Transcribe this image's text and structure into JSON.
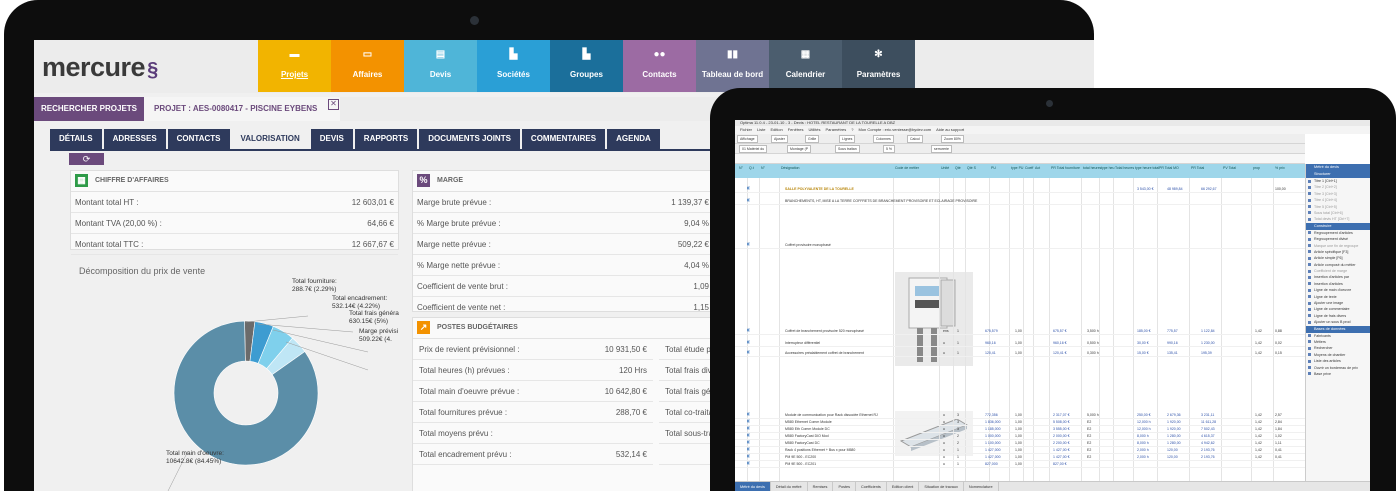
{
  "crm": {
    "logo": "mercure",
    "nav": [
      {
        "label": "Projets",
        "color": "#f2b400",
        "icon": "folder-icon"
      },
      {
        "label": "Affaires",
        "color": "#f39200",
        "icon": "folder-open-icon"
      },
      {
        "label": "Devis",
        "color": "#4fb5d8",
        "icon": "document-icon"
      },
      {
        "label": "Sociétés",
        "color": "#2a9fd6",
        "icon": "factory-icon"
      },
      {
        "label": "Groupes",
        "color": "#1b6f9b",
        "icon": "factory-group-icon"
      },
      {
        "label": "Contacts",
        "color": "#9c6ba3",
        "icon": "people-icon"
      },
      {
        "label": "Tableau de bord",
        "color": "#6f7392",
        "icon": "bar-chart-icon"
      },
      {
        "label": "Calendrier",
        "color": "#4b5d6e",
        "icon": "calendar-icon"
      },
      {
        "label": "Paramètres",
        "color": "#3d4e5e",
        "icon": "gears-icon"
      }
    ],
    "search_tab": "RECHERCHER PROJETS",
    "project_tab": "PROJET : AES-0080417 - PISCINE EYBENS",
    "close_symbol": "✕",
    "subtabs": [
      "DÉTAILS",
      "ADRESSES",
      "CONTACTS",
      "VALORISATION",
      "DEVIS",
      "RAPPORTS",
      "DOCUMENTS JOINTS",
      "COMMENTAIRES",
      "AGENDA"
    ],
    "chiffre": {
      "title": "CHIFFRE D'AFFAIRES",
      "rows": [
        {
          "label": "Montant total HT :",
          "value": "12 603,01 €"
        },
        {
          "label": "Montant TVA (20,00 %) :",
          "value": "64,66 €"
        },
        {
          "label": "Montant total TTC :",
          "value": "12 667,67 €"
        }
      ]
    },
    "marge": {
      "title": "MARGE",
      "rows": [
        {
          "label": "Marge brute prévue :",
          "value": "1 139,37 €"
        },
        {
          "label": "% Marge brute prévue :",
          "value": "9,04 %"
        },
        {
          "label": "Marge nette prévue :",
          "value": "509,22 €"
        },
        {
          "label": "% Marge nette prévue :",
          "value": "4,04 %"
        },
        {
          "label": "Coefficient de vente brut :",
          "value": "1,09"
        },
        {
          "label": "Coefficient de vente net :",
          "value": "1,15"
        }
      ]
    },
    "postes": {
      "title": "POSTES BUDGÉTAIRES",
      "rows": [
        {
          "label": "Prix de revient prévisionnel :",
          "value": "10 931,50 €",
          "right": "Total étude prév"
        },
        {
          "label": "Total heures (h) prévues :",
          "value": "120 Hrs",
          "right": "Total frais divers p"
        },
        {
          "label": "Total main d'oeuvre prévue :",
          "value": "10 642,80 €",
          "right": "Total frais généra"
        },
        {
          "label": "Total fournitures prévue :",
          "value": "288,70 €",
          "right": "Total co-traitance"
        },
        {
          "label": "Total moyens prévu :",
          "value": "",
          "right": "Total sous-traitan"
        },
        {
          "label": "Total encadrement prévu :",
          "value": "532,14 €",
          "right": ""
        }
      ]
    },
    "pie_title": "Décomposition du prix de vente",
    "pie_labels": [
      {
        "name": "Total fourniture:",
        "value": "288.7€ (2.29%)"
      },
      {
        "name": "Total encadrement:",
        "value": "532.14€ (4.22%)"
      },
      {
        "name": "Total frais généra",
        "value": "630.15€ (5%)"
      },
      {
        "name": "Marge prévisi",
        "value": "509.22€ (4."
      },
      {
        "name": "Total main d'oeuvre:",
        "value": "10642.8€ (84.45%)"
      }
    ]
  },
  "chart_data": {
    "type": "pie",
    "title": "Décomposition du prix de vente",
    "categories": [
      "Total main d'oeuvre",
      "Total fourniture",
      "Total encadrement",
      "Total frais généraux",
      "Marge prévisionnelle"
    ],
    "values": [
      10642.8,
      288.7,
      532.14,
      630.15,
      509.22
    ],
    "percent": [
      84.45,
      2.29,
      4.22,
      5.0,
      4.04
    ],
    "colors": [
      "#5b8ea8",
      "#6b6b6b",
      "#3d9cd1",
      "#7fd0ec",
      "#bfe6f5"
    ],
    "donut": true
  },
  "optima": {
    "window_title": "Optima 11.0.4 - 23-01-10 - 3 - Devis : HOTEL RESTAURANT DE LA TOURELLE A DBZ",
    "menu": [
      "Fichier",
      "Liste",
      "Edition",
      "Fenêtres",
      "Utilités",
      "Paramètres",
      "?",
      "Mon Compte : eric.veniesse@bydev.com",
      "Aide au support"
    ],
    "toolbar1": [
      "Affichage",
      "Ajuster",
      "Grille",
      "Lignes",
      "Colonnes",
      "Calcul",
      "Zoom 80%"
    ],
    "toolbar2": [
      "01 Matériel du",
      "Montage (P",
      "Sous traitan",
      "5 %",
      "serrurerie"
    ],
    "columns": [
      "N°",
      "Q.t",
      "N°",
      "Désignation",
      "Code de métier",
      "Unité",
      "Qté",
      "Qté S",
      "PU",
      "type PU",
      "Coeff",
      "Act",
      "PR Total fourniture",
      "total heures",
      "type heu",
      "Total heures",
      "type heure total",
      "PR Total MO",
      "PR Total",
      "PV Total",
      "prop",
      "% prix"
    ],
    "rows": [
      {
        "designation": "SALLE POLYVALENTE DE LA TOURELLE",
        "unit": "",
        "qty": "",
        "pu": "",
        "coeff": "",
        "pr_fourn": "",
        "mo": "",
        "pr_total": "3 543,00 €",
        "pv_total": "48 989,84",
        "extra": "66 292,67",
        "prop": "",
        "pct": "100,00"
      },
      {
        "designation": "BRANCHEMENTS, HT, MISE A LA TERRE COFFRETS DE BRANCHEMENT PROVISOIRE ET ECLAIRAGE PROVISOIRE",
        "unit": "",
        "qty": "",
        "pu": "",
        "coeff": "",
        "pr_fourn": "",
        "mo": "",
        "pr_total": "",
        "pv_total": "",
        "extra": "",
        "prop": "",
        "pct": ""
      },
      {
        "designation": "Coffret provisoire monophasé",
        "unit": "",
        "qty": "",
        "pu": "",
        "coeff": "",
        "pr_fourn": "",
        "mo": "",
        "pr_total": "",
        "pv_total": "",
        "extra": "",
        "prop": "",
        "pct": ""
      },
      {
        "designation": "Coffret de branchement provisoire 520 monophasé",
        "unit": "ens",
        "qty": "1",
        "pu": "675,579",
        "coeff": "1,00",
        "pr_fourn": "675,57 €",
        "mo": "3,500 h",
        "pr_total": "185,00 €",
        "pv_total": "775,57",
        "extra": "1 122,84",
        "prop": "1,42",
        "pct": "0,88"
      },
      {
        "designation": "Interrupteur différentiel",
        "unit": "u",
        "qty": "1",
        "pu": "960,16",
        "coeff": "1,00",
        "pr_fourn": "960,16 €",
        "mo": "0,500 h",
        "pr_total": "30,00 €",
        "pv_total": "990,16",
        "extra": "1 230,00",
        "prop": "1,42",
        "pct": "0,02"
      },
      {
        "designation": "Accessoires préalablement coffret de branchement",
        "unit": "u",
        "qty": "1",
        "pu": "120,41",
        "coeff": "1,00",
        "pr_fourn": "120,41 €",
        "mo": "0,300 h",
        "pr_total": "15,00 €",
        "pv_total": "135,41",
        "extra": "195,39",
        "prop": "1,42",
        "pct": "0,15"
      },
      {
        "designation": "Module de communication pour Rack dissociée Ethernet RJ",
        "unit": "u",
        "qty": "3",
        "pu": "772,356",
        "coeff": "1,00",
        "pr_fourn": "2 317,07 €",
        "mo": "5,000 h",
        "pr_total": "250,00 €",
        "pv_total": "2 679,36",
        "extra": "3 231,11",
        "prop": "1,42",
        "pct": "2,57"
      },
      {
        "designation": "M580 Ethernet Comm Module",
        "unit": "u",
        "qty": "3",
        "pu": "1 836,000",
        "coeff": "1,00",
        "pr_fourn": "5 508,00 €",
        "mo": "E2",
        "pr_total": "12,000 h",
        "pv_total": "1 920,00",
        "extra": "11 611,28",
        "prop": "1,42",
        "pct": "2,84"
      },
      {
        "designation": "M580 Eth Comm Module DC",
        "unit": "u",
        "qty": "3",
        "pu": "1 185,000",
        "coeff": "1,00",
        "pr_fourn": "3 555,00 €",
        "mo": "E2",
        "pr_total": "12,000 h",
        "pv_total": "1 920,00",
        "extra": "7 502,43",
        "prop": "1,42",
        "pct": "1,84"
      },
      {
        "designation": "M580 FactoryCast DIO Mod",
        "unit": "u",
        "qty": "2",
        "pu": "1 000,000",
        "coeff": "1,00",
        "pr_fourn": "2 000,00 €",
        "mo": "E2",
        "pr_total": "8,000 h",
        "pv_total": "1 280,00",
        "extra": "4 615,37",
        "prop": "1,42",
        "pct": "1,02"
      },
      {
        "designation": "M580 FactoryCast DC",
        "unit": "u",
        "qty": "2",
        "pu": "1 100,000",
        "coeff": "1,00",
        "pr_fourn": "2 200,00 €",
        "mo": "E2",
        "pr_total": "8,000 h",
        "pv_total": "1 280,00",
        "extra": "4 942,62",
        "prop": "1,42",
        "pct": "1,11"
      },
      {
        "designation": "Rack 4 positions Ethernet + Bus x pour M580",
        "unit": "u",
        "qty": "1",
        "pu": "1 427,000",
        "coeff": "1,00",
        "pr_fourn": "1 427,00 €",
        "mo": "E2",
        "pr_total": "2,000 h",
        "pv_total": "120,00",
        "extra": "2 193,76",
        "prop": "1,42",
        "pct": "0,41"
      },
      {
        "designation": "PM 9E 500 - EC200",
        "unit": "u",
        "qty": "1",
        "pu": "1 427,000",
        "coeff": "1,00",
        "pr_fourn": "1 427,00 €",
        "mo": "E2",
        "pr_total": "2,000 h",
        "pv_total": "120,00",
        "extra": "2 193,76",
        "prop": "1,42",
        "pct": "0,41"
      },
      {
        "designation": "PM 9E 500 - EC201",
        "unit": "u",
        "qty": "1",
        "pu": "827,000",
        "coeff": "1,00",
        "pr_fourn": "827,00 €",
        "mo": "",
        "pr_total": "",
        "pv_total": "",
        "extra": "",
        "prop": "",
        "pct": ""
      }
    ],
    "side_panel": {
      "sections": [
        {
          "title": "Métré du devis",
          "items": []
        },
        {
          "title": "Structurer",
          "items": [
            "Titre 1 [Ctrl+1]",
            "Titre 2 [Ctrl+2]",
            "Titre 3 [Ctrl+3]",
            "Titre 4 [Ctrl+4]",
            "Titre 5 [Ctrl+5]",
            "Sous total [Ctrl+6]",
            "Total devis HT [Ctrl+7]"
          ]
        },
        {
          "title": "Construire",
          "items": [
            "Regroupement d'articles",
            "Regroupement divisé",
            "Marque une fin de regroupe",
            "Article spécifique [F3]",
            "Article simple [F6]",
            "Article composé du métier",
            "Coefficient de marge",
            "Insertion d'articles par",
            "Insertion d'articles",
            "Ligne de main d'oeuvre",
            "Ligne de texte",
            "Ajouter une image",
            "Ligne de commentaire",
            "Ligne de frais divers",
            "Ajouter un sous B prod"
          ]
        },
        {
          "title": "Bases de données",
          "items": [
            "Fabricants",
            "Métiers",
            "Rechercher",
            "Moyens de chantier",
            "Liste des articles",
            "Ouvrir un bordereau de prix",
            "Base prixe"
          ]
        }
      ]
    },
    "bottom_tabs": [
      "Métré du devis",
      "Détail du métré",
      "Remises",
      "Postes",
      "Coefficients",
      "Edition client",
      "Situation de travaux",
      "Nomenclature"
    ]
  }
}
